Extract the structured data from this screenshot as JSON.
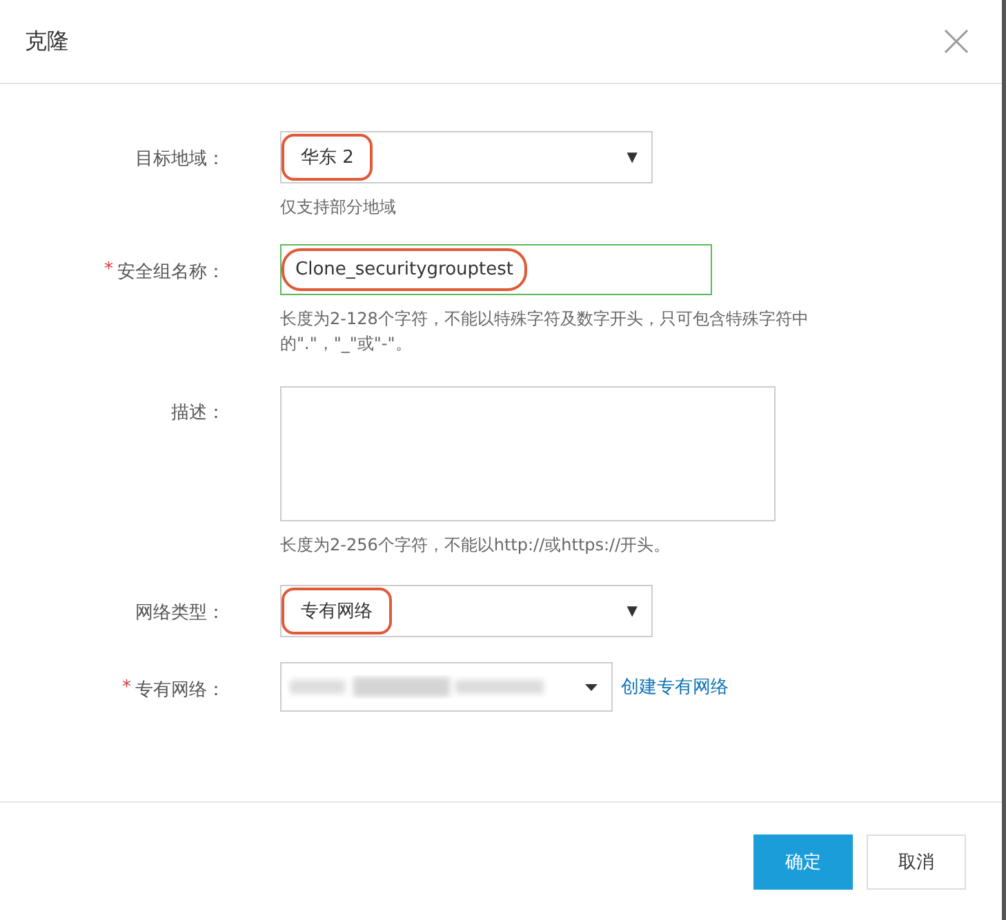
{
  "dialog": {
    "title": "克隆"
  },
  "fields": [
    {
      "kind": "select",
      "label": "目标地域：",
      "required": false,
      "value": "华东 2",
      "arrow": "▼",
      "highlighted": true,
      "hint": "仅支持部分地域"
    },
    {
      "kind": "input",
      "label": "安全组名称：",
      "required": true,
      "required_mark": "*",
      "value": "Clone_securitygrouptest",
      "valid": true,
      "highlighted": true,
      "hint": "长度为2-128个字符，不能以特殊字符及数字开头，只可包含特殊字符中的\".\"，\"_\"或\"-\"。"
    },
    {
      "kind": "textarea",
      "label": "描述：",
      "required": false,
      "hint": "长度为2-256个字符，不能以http://或https://开头。"
    },
    {
      "kind": "select",
      "label": "网络类型：",
      "required": false,
      "value": "专有网络",
      "arrow": "▼",
      "highlighted": true
    },
    {
      "kind": "redacted-select",
      "label": "专有网络：",
      "required": true,
      "required_mark": "*",
      "link": "创建专有网络"
    }
  ],
  "buttons": [
    {
      "label": "确定",
      "primary": true
    },
    {
      "label": "取消",
      "primary": false
    }
  ]
}
